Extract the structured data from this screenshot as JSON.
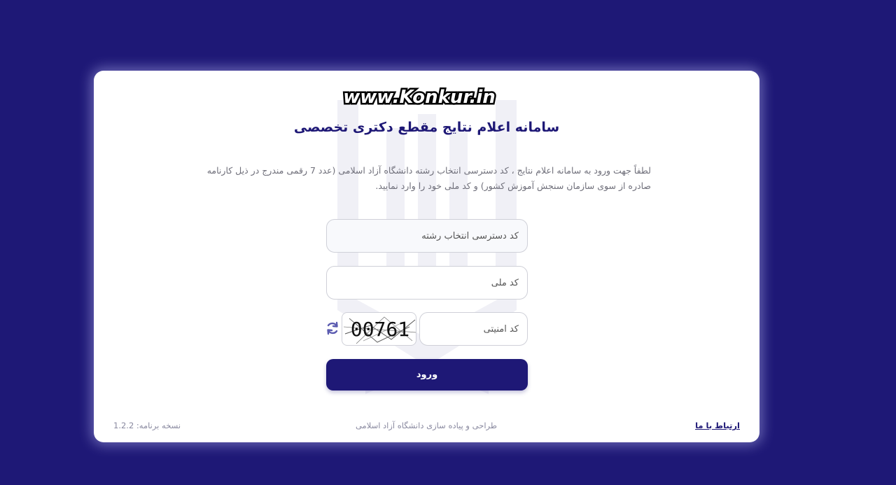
{
  "watermark": "www.Konkur.in",
  "title": "سامانه اعلام نتایج مقطع دکتری تخصصی",
  "description": "لطفاً جهت ورود به سامانه اعلام نتایج ، کد دسترسی انتخاب رشته دانشگاه آزاد اسلامی (عدد 7 رقمی مندرج در ذیل کارنامه صادره از سوی سازمان سنجش آموزش کشور) و کد ملی خود را وارد نمایید.",
  "form": {
    "access_code_placeholder": "کد دسترسی انتخاب رشته",
    "national_code_placeholder": "کد ملی",
    "security_code_placeholder": "کد امنیتی",
    "captcha_text": "00761",
    "submit_label": "ورود"
  },
  "footer": {
    "contact_link": "ارتباط با ما",
    "credit": "طراحی و پیاده سازی دانشگاه آزاد اسلامی",
    "version_label": "نسخه برنامه:",
    "version": "1.2.2"
  },
  "colors": {
    "background": "#1e1876",
    "primary": "#1e1876",
    "card": "#ffffff"
  },
  "icons": {
    "refresh": "refresh-icon",
    "emblem": "university-emblem"
  }
}
